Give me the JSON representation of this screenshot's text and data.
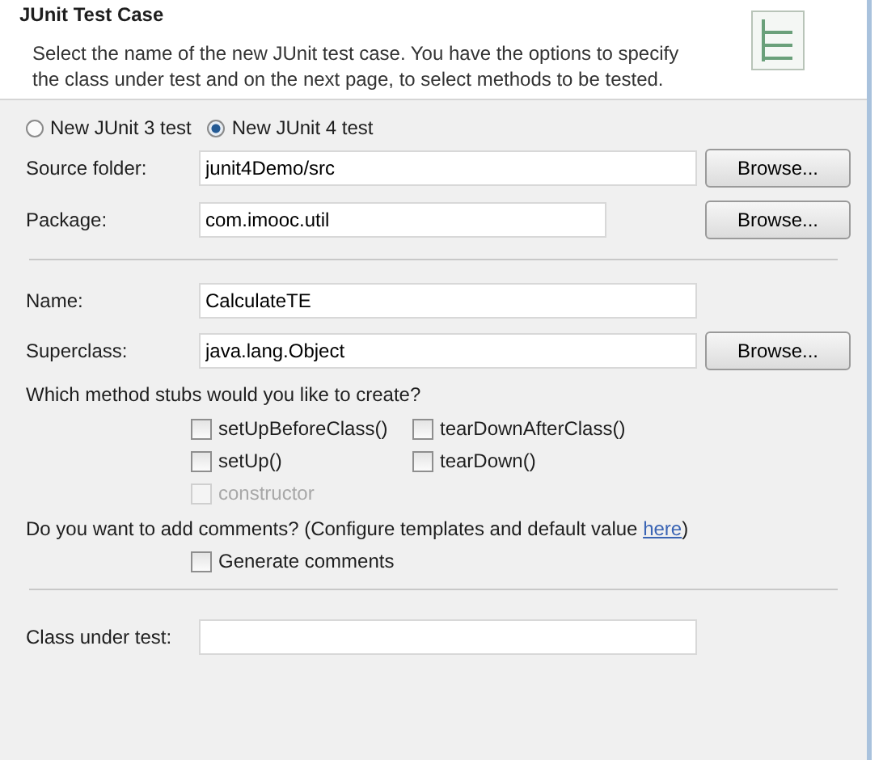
{
  "header": {
    "title": "JUnit Test Case",
    "description": "Select the name of the new JUnit test case. You have the options to specify the class under test and on the next page, to select methods to be tested."
  },
  "test_version": [
    {
      "label": "New JUnit 3 test",
      "selected": false
    },
    {
      "label": "New JUnit 4 test",
      "selected": true
    }
  ],
  "location_fields": [
    {
      "label": "Source folder:",
      "value": "junit4Demo/src",
      "button": "Browse..."
    },
    {
      "label": "Package:",
      "value": "com.imooc.util",
      "button": "Browse..."
    }
  ],
  "class_fields": [
    {
      "label": "Name:",
      "value": "CalculateTE"
    },
    {
      "label": "Superclass:",
      "value": "java.lang.Object",
      "button": "Browse..."
    }
  ],
  "stubs_prompt": "Which method stubs would you like to create?",
  "stubs": [
    {
      "label": "setUpBeforeClass()",
      "checked": false,
      "disabled": false
    },
    {
      "label": "tearDownAfterClass()",
      "checked": false,
      "disabled": false
    },
    {
      "label": "setUp()",
      "checked": false,
      "disabled": false
    },
    {
      "label": "tearDown()",
      "checked": false,
      "disabled": false
    },
    {
      "label": "constructor",
      "checked": false,
      "disabled": true
    }
  ],
  "comments": {
    "prompt": "Do you want to add comments? (Configure templates and default value ",
    "link": "here",
    "prompt_end": ")",
    "option": {
      "label": "Generate comments",
      "checked": false
    }
  },
  "class_under_test": {
    "label": "Class under test:"
  }
}
